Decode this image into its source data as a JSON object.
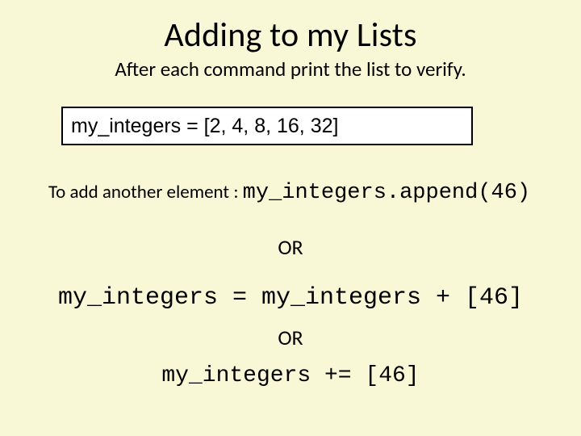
{
  "title": "Adding to my Lists",
  "subtitle": "After each command print the list to verify.",
  "codebox": "my_integers = [2, 4, 8, 16, 32]",
  "add_label": "To add another element : ",
  "add_code": "my_integers.append(46)",
  "or": "OR",
  "concat_code": "my_integers = my_integers + [46]",
  "aug_code": "my_integers += [46]"
}
